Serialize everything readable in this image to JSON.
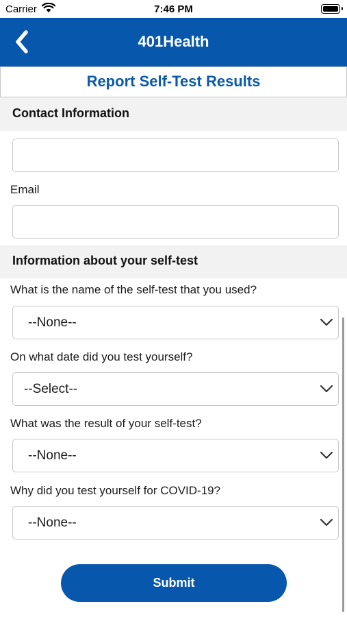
{
  "status_bar": {
    "carrier": "Carrier",
    "time": "7:46 PM"
  },
  "header": {
    "title": "401Health",
    "back_icon": "chevron-left-icon"
  },
  "page": {
    "title": "Report Self-Test Results"
  },
  "contact_section": {
    "title": "Contact Information",
    "first_field_value": "",
    "email_label": "Email",
    "email_value": ""
  },
  "selftest_section": {
    "title": "Information about your self-test",
    "questions": [
      {
        "label": "What is the name of the self-test that you used?",
        "selected": "--None--"
      },
      {
        "label": "On what date did you test yourself?",
        "selected": "--Select--"
      },
      {
        "label": "What was the result of your self-test?",
        "selected": "--None--"
      },
      {
        "label": "Why did you test yourself for COVID-19?",
        "selected": "--None--"
      }
    ]
  },
  "actions": {
    "submit_label": "Submit"
  },
  "colors": {
    "brand_blue": "#0758ad",
    "title_blue": "#0b5aa8",
    "section_bg": "#f2f2f2",
    "border": "#c8c8c8"
  }
}
